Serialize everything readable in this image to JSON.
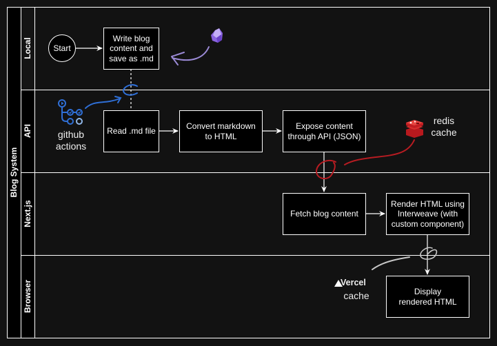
{
  "diagram": {
    "title": "Blog System",
    "lanes": [
      {
        "id": "local",
        "label": "Local"
      },
      {
        "id": "api",
        "label": "API"
      },
      {
        "id": "nextjs",
        "label": "Next.js"
      },
      {
        "id": "browser",
        "label": "Browser"
      }
    ],
    "nodes": {
      "start": "Start",
      "write_blog": "Write blog content and save as .md",
      "read_md": "Read .md file",
      "convert": "Convert markdown to HTML",
      "expose": "Expose content through API (JSON)",
      "fetch": "Fetch blog content",
      "render": "Render HTML using Interweave (with custom component)",
      "display": "Display rendered HTML"
    },
    "annotations": {
      "github": {
        "line1": "github",
        "line2": "actions",
        "icon": "github-actions-icon",
        "color": "#2f6fd6"
      },
      "redis": {
        "line1": "redis",
        "line2": "cache",
        "icon": "redis-icon",
        "color": "#c0181e"
      },
      "vercel": {
        "brand": "Vercel",
        "line2": "cache",
        "icon": "vercel-triangle-icon",
        "color": "#dddddd"
      },
      "obsidian": {
        "icon": "obsidian-icon",
        "color": "#9b7be8"
      }
    },
    "colors": {
      "background": "#121212",
      "lane_header": "#000000",
      "box_fill": "#000000",
      "stroke": "#ffffff"
    }
  }
}
